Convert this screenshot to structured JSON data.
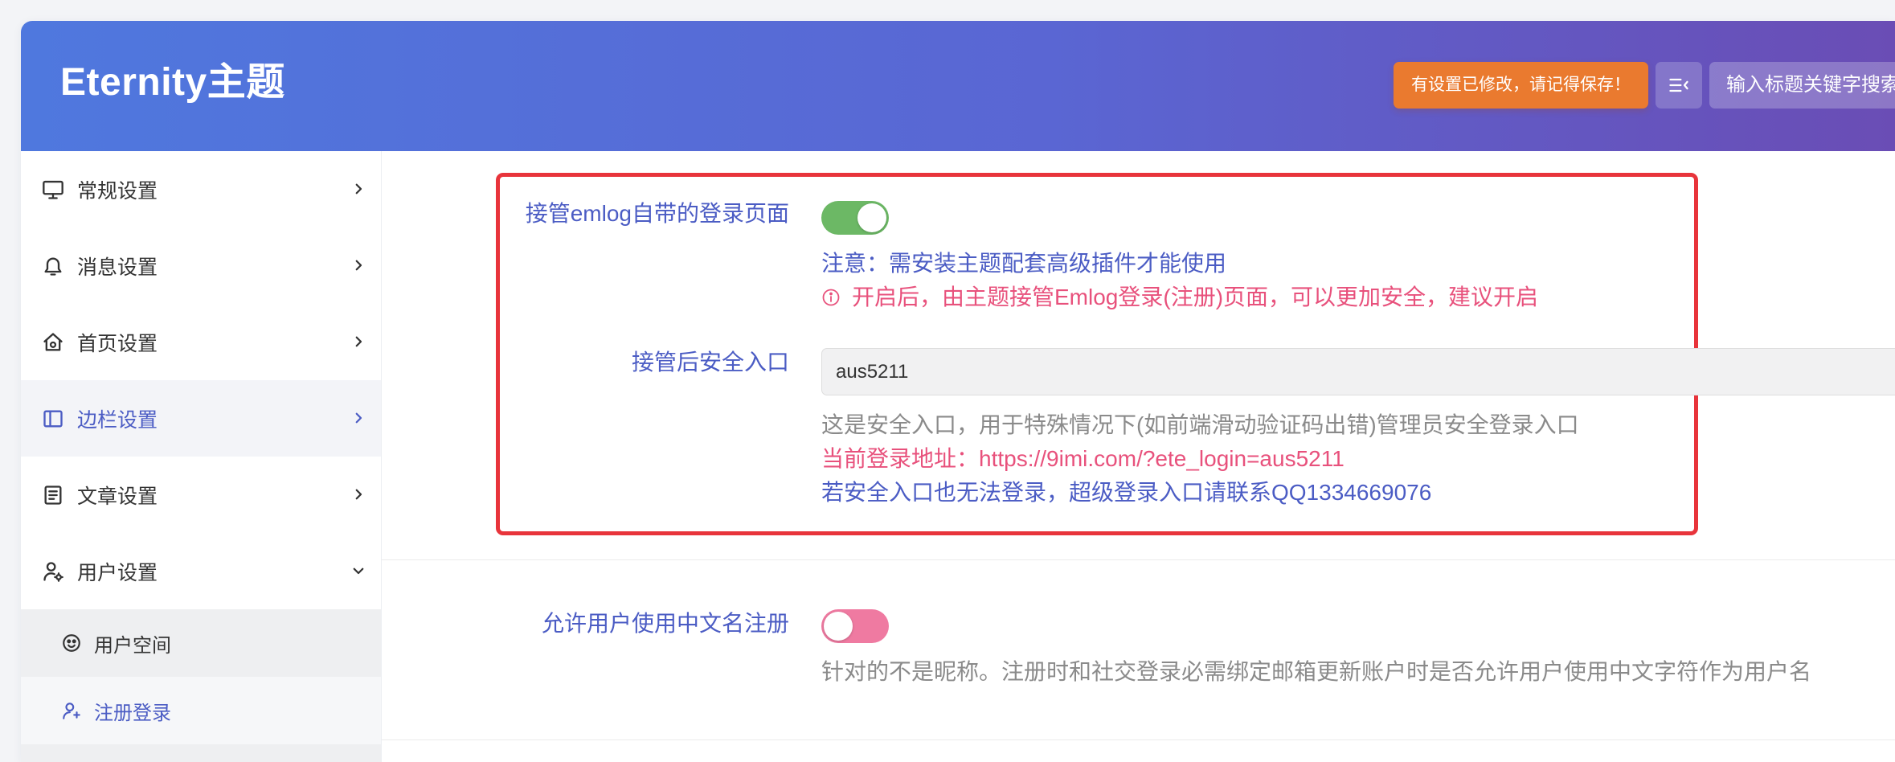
{
  "theme": {
    "accent": "#4b5cc4",
    "warning": "#e8517c",
    "muted": "#8a8a8a",
    "text": "#333333",
    "toggle_on": "#6cb865",
    "toggle_off": "#ef7aa1",
    "notice": "#ea7a2f",
    "highlight": "#e8343b",
    "header_start": "#4f78de",
    "header_end": "#6a4db5"
  },
  "header": {
    "title": "Eternity主题",
    "unsaved_notice": "有设置已修改，请记得保存！",
    "menu_icon": "menu-fold-icon",
    "search_placeholder": "输入标题关键字搜索"
  },
  "sidebar": {
    "items": [
      {
        "label": "常规设置",
        "icon": "monitor-icon",
        "active": false
      },
      {
        "label": "消息设置",
        "icon": "bell-icon",
        "active": false
      },
      {
        "label": "首页设置",
        "icon": "home-settings-icon",
        "active": false
      },
      {
        "label": "边栏设置",
        "icon": "sidebar-layout-icon",
        "active": true
      },
      {
        "label": "文章设置",
        "icon": "document-icon",
        "active": false
      },
      {
        "label": "用户设置",
        "icon": "user-settings-icon",
        "active": false,
        "expanded": true,
        "children": [
          {
            "label": "用户空间",
            "icon": "smiley-icon",
            "active": false
          },
          {
            "label": "注册登录",
            "icon": "user-plus-icon",
            "active": true
          }
        ]
      }
    ]
  },
  "settings": {
    "login_takeover": {
      "label": "接管emlog自带的登录页面",
      "enabled": true,
      "note": "注意：需安装主题配套高级插件才能使用",
      "tip": "开启后，由主题接管Emlog登录(注册)页面，可以更加安全，建议开启"
    },
    "secure_entry": {
      "label": "接管后安全入口",
      "value": "aus5211",
      "help": "这是安全入口，用于特殊情况下(如前端滑动验证码出错)管理员安全登录入口",
      "current_url_label": "当前登录地址：",
      "current_url": "https://9imi.com/?ete_login=aus5211",
      "contact": "若安全入口也无法登录，超级登录入口请联系QQ1334669076"
    },
    "chinese_username": {
      "label": "允许用户使用中文名注册",
      "enabled": false,
      "help": "针对的不是昵称。注册时和社交登录必需绑定邮箱更新账户时是否允许用户使用中文字符作为用户名"
    }
  }
}
